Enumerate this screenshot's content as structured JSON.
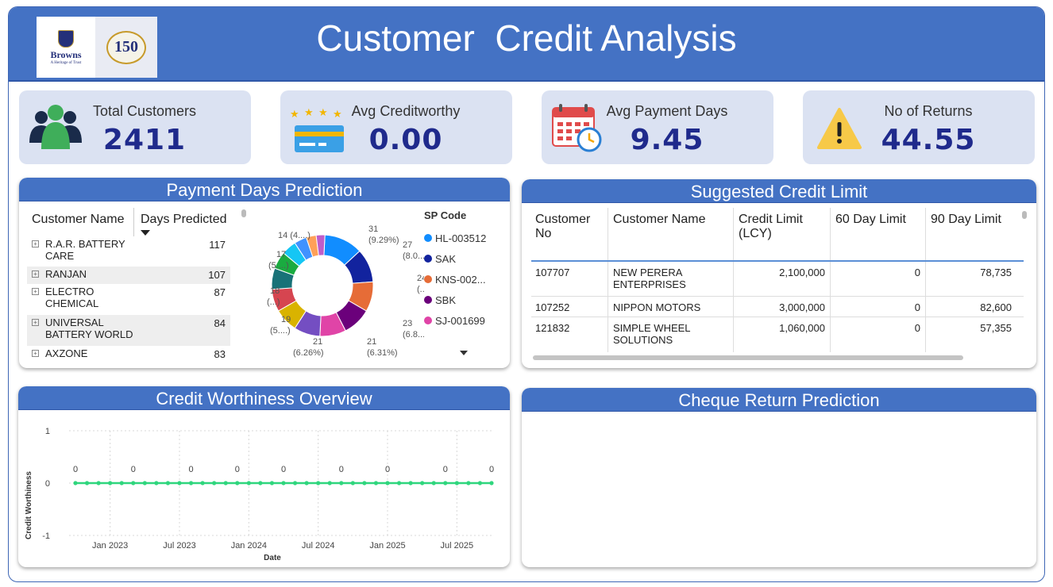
{
  "header": {
    "title": "Customer  Credit Analysis",
    "logo_brand": "Browns",
    "logo_tagline": "A Heritage of Trust",
    "logo_seal": "150"
  },
  "kpis": [
    {
      "label": "Total Customers",
      "value": "2411",
      "icon": "people-icon"
    },
    {
      "label": "Avg Creditworthy",
      "value": "0.00",
      "icon": "credit-card-stars-icon"
    },
    {
      "label": "Avg Payment Days",
      "value": "9.45",
      "icon": "calendar-clock-icon"
    },
    {
      "label": "No of Returns",
      "value": "44.55",
      "icon": "warning-icon"
    }
  ],
  "payment_days": {
    "title": "Payment Days Prediction",
    "col1": "Customer Name",
    "col2": "Days Predicted",
    "rows": [
      {
        "name": "R.A.R. BATTERY CARE",
        "days": "117"
      },
      {
        "name": "RANJAN",
        "days": "107"
      },
      {
        "name": "ELECTRO CHEMICAL",
        "days": "87"
      },
      {
        "name": "UNIVERSAL BATTERY WORLD",
        "days": "84"
      },
      {
        "name": "AXZONE",
        "days": "83"
      }
    ],
    "donut": {
      "labels": [
        {
          "line1": "31",
          "line2": "(9.29%)"
        },
        {
          "line1": "27",
          "line2": "(8.0...)"
        },
        {
          "line1": "24",
          "line2": "(...)"
        },
        {
          "line1": "23",
          "line2": "(6.8...)"
        },
        {
          "line1": "21",
          "line2": "(6.31%)"
        },
        {
          "line1": "21",
          "line2": "(6.26%)"
        },
        {
          "line1": "19",
          "line2": "(5....)"
        },
        {
          "line1": "18",
          "line2": "(...)"
        },
        {
          "line1": "17",
          "line2": "(5....)"
        },
        {
          "line1": "14 (4....)",
          "line2": ""
        }
      ],
      "legend_title": "SP Code",
      "legend": [
        {
          "name": "HL-003512",
          "color": "#118dff"
        },
        {
          "name": "SAK",
          "color": "#12239e"
        },
        {
          "name": "KNS-002...",
          "color": "#e66c37"
        },
        {
          "name": "SBK",
          "color": "#6b007b"
        },
        {
          "name": "SJ-001699",
          "color": "#e044a7"
        }
      ]
    }
  },
  "credit_limit": {
    "title": "Suggested Credit Limit",
    "headers": [
      "Customer No",
      "Customer Name",
      "Credit Limit (LCY)",
      "60 Day Limit",
      "90 Day Limit"
    ],
    "rows": [
      [
        "107707",
        "NEW PERERA ENTERPRISES",
        "2,100,000",
        "0",
        "78,735"
      ],
      [
        "107252",
        "NIPPON MOTORS",
        "3,000,000",
        "0",
        "82,600"
      ],
      [
        "121832",
        "SIMPLE WHEEL SOLUTIONS",
        "1,060,000",
        "0",
        "57,355"
      ]
    ]
  },
  "credit_worthiness": {
    "title": "Credit Worthiness Overview"
  },
  "cheque_return": {
    "title": "Cheque Return Prediction"
  },
  "chart_data": {
    "type": "line",
    "xlabel": "Date",
    "ylabel": "Credit Worthiness",
    "ylim": [
      -1,
      1
    ],
    "yticks": [
      "1",
      "0",
      "-1"
    ],
    "xticks": [
      "Jan 2023",
      "Jul 2023",
      "Jan 2024",
      "Jul 2024",
      "Jan 2025",
      "Jul 2025"
    ],
    "x": [
      "2022-10",
      "2022-11",
      "2022-12",
      "2023-01",
      "2023-02",
      "2023-03",
      "2023-04",
      "2023-05",
      "2023-06",
      "2023-07",
      "2023-08",
      "2023-09",
      "2023-10",
      "2023-11",
      "2023-12",
      "2024-01",
      "2024-02",
      "2024-03",
      "2024-04",
      "2024-05",
      "2024-06",
      "2024-07",
      "2024-08",
      "2024-09",
      "2024-10",
      "2024-11",
      "2024-12",
      "2025-01",
      "2025-02",
      "2025-03",
      "2025-04",
      "2025-05",
      "2025-06",
      "2025-07",
      "2025-08",
      "2025-09",
      "2025-10"
    ],
    "values": [
      0,
      0,
      0,
      0,
      0,
      0,
      0,
      0,
      0,
      0,
      0,
      0,
      0,
      0,
      0,
      0,
      0,
      0,
      0,
      0,
      0,
      0,
      0,
      0,
      0,
      0,
      0,
      0,
      0,
      0,
      0,
      0,
      0,
      0,
      0,
      0,
      0
    ],
    "data_labels": [
      "0",
      "0",
      "0",
      "0",
      "0",
      "0",
      "0",
      "0",
      "0"
    ],
    "series_color": "#2fd67d",
    "grid": true
  }
}
